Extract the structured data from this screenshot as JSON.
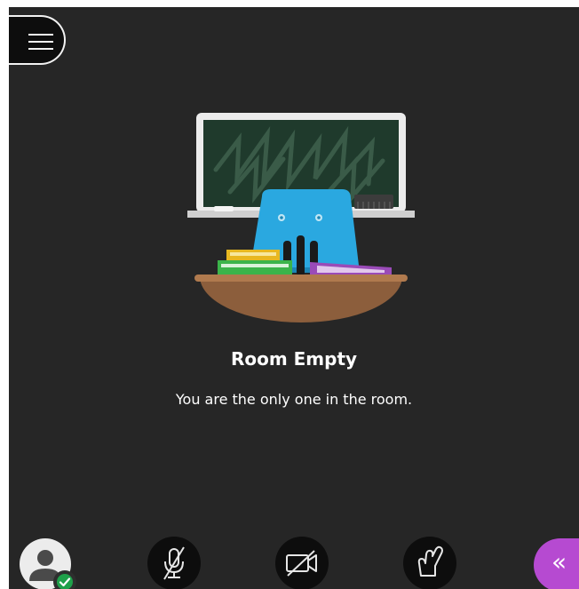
{
  "room": {
    "title": "Room Empty",
    "message": "You are the only one in the room."
  },
  "controls": {
    "menu_icon": "hamburger-icon",
    "avatar_icon": "user-avatar-icon",
    "status_icon": "check-icon",
    "microphone_icon": "microphone-off-icon",
    "camera_icon": "camera-off-icon",
    "hand_icon": "raise-hand-icon",
    "panel_toggle": "«"
  },
  "colors": {
    "background": "#262626",
    "control": "#0d0d0d",
    "accent": "#b64ad1",
    "status": "#1fa04a"
  }
}
